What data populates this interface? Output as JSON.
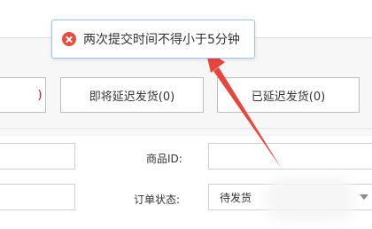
{
  "toast": {
    "message": "两次提交时间不得小于5分钟",
    "icon": "error-icon"
  },
  "tabs": {
    "partial_suffix": ")",
    "coming_soon": "即将延迟发货(0)",
    "extended": "已延迟发货(0)"
  },
  "form": {
    "product_id_label": "商品ID:",
    "order_status_label": "订单状态:",
    "order_status_value": "待发货"
  },
  "colors": {
    "accent_red": "#d0021b",
    "error_icon": "#e54d42",
    "annotation_arrow": "#e8453c",
    "toast_border": "#9fc3ea"
  }
}
